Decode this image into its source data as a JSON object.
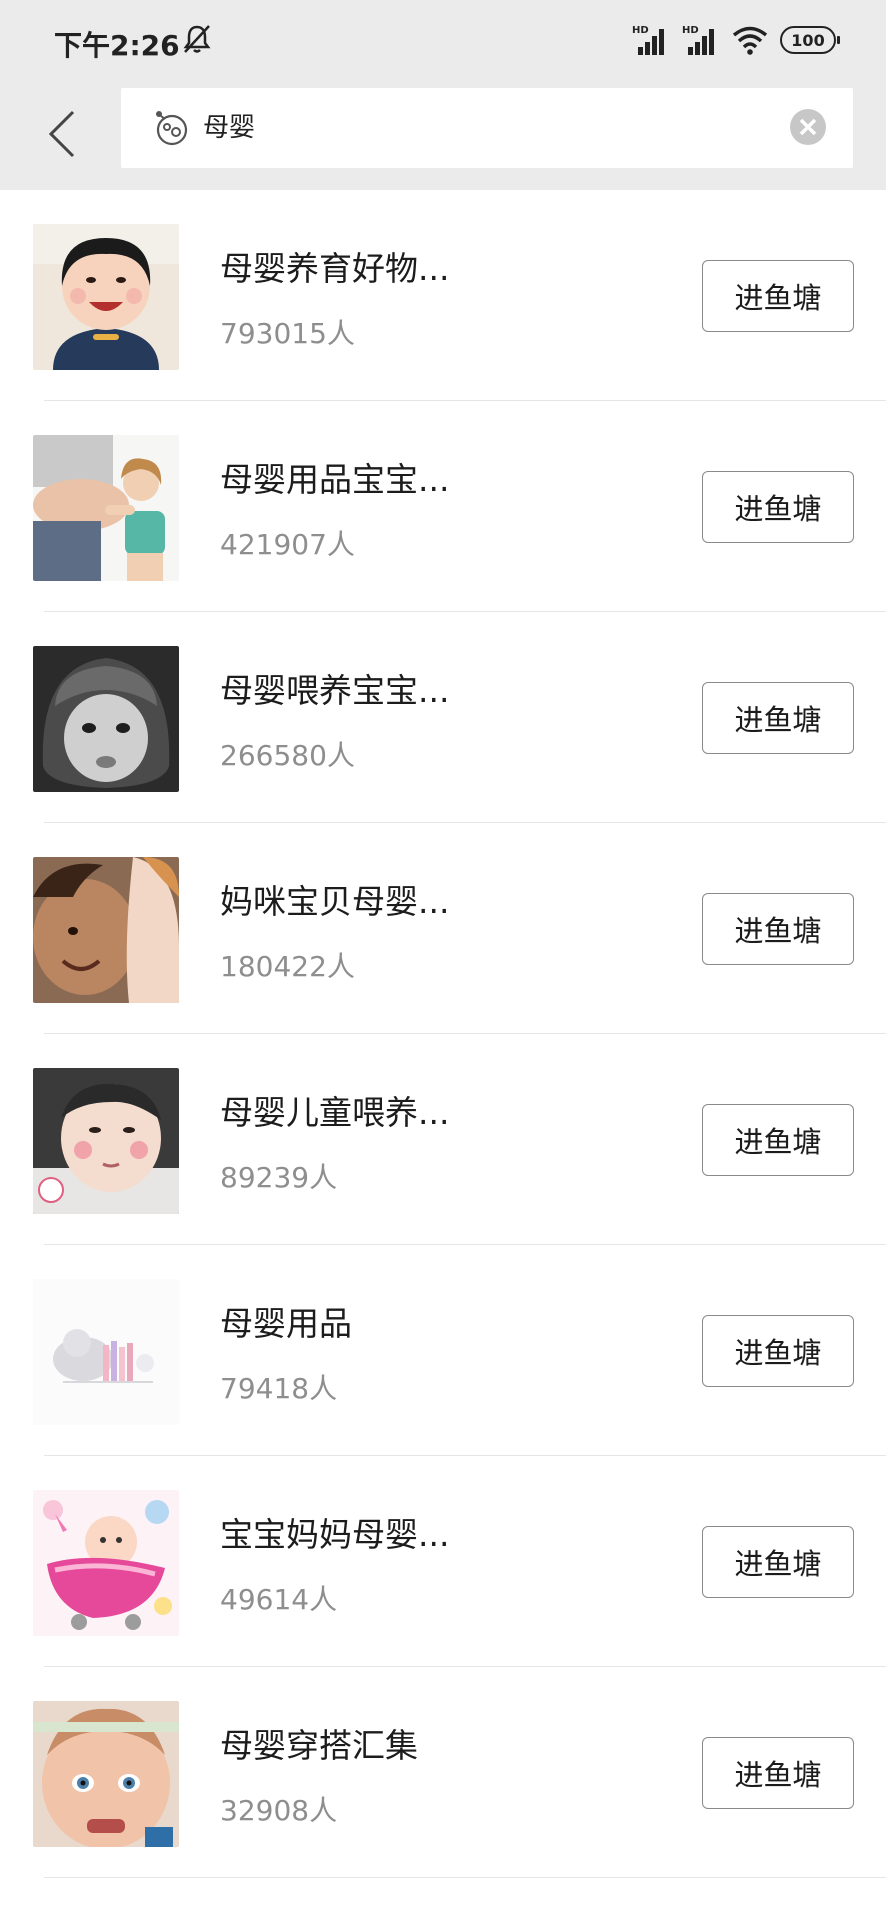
{
  "status_bar": {
    "time": "下午2:26",
    "network_labels": [
      "HD",
      "HD"
    ],
    "battery": "100",
    "icons": [
      "bell-off-icon",
      "signal-icon",
      "signal-icon",
      "wifi-icon",
      "battery-icon"
    ]
  },
  "header": {
    "back_icon": "chevron-left-icon",
    "search": {
      "leading_icon": "emoji-icon",
      "query": "母婴",
      "clear_icon": "clear-circle-icon"
    }
  },
  "results": [
    {
      "title": "母婴养育好物...",
      "count": "793015人",
      "action": "进鱼塘",
      "thumb": "baby-laughing"
    },
    {
      "title": "母婴用品宝宝...",
      "count": "421907人",
      "action": "进鱼塘",
      "thumb": "pregnant-belly-girl"
    },
    {
      "title": "母婴喂养宝宝...",
      "count": "266580人",
      "action": "进鱼塘",
      "thumb": "bw-baby-helmet"
    },
    {
      "title": "妈咪宝贝母婴...",
      "count": "180422人",
      "action": "进鱼塘",
      "thumb": "mother-baby"
    },
    {
      "title": "母婴儿童喂养...",
      "count": "89239人",
      "action": "进鱼塘",
      "thumb": "infant-cheeks"
    },
    {
      "title": "母婴用品",
      "count": "79418人",
      "action": "进鱼塘",
      "thumb": "elephant-books"
    },
    {
      "title": "宝宝妈妈母婴...",
      "count": "49614人",
      "action": "进鱼塘",
      "thumb": "cartoon-stroller"
    },
    {
      "title": "母婴穿搭汇集",
      "count": "32908人",
      "action": "进鱼塘",
      "thumb": "baby-blue-eyes"
    }
  ]
}
